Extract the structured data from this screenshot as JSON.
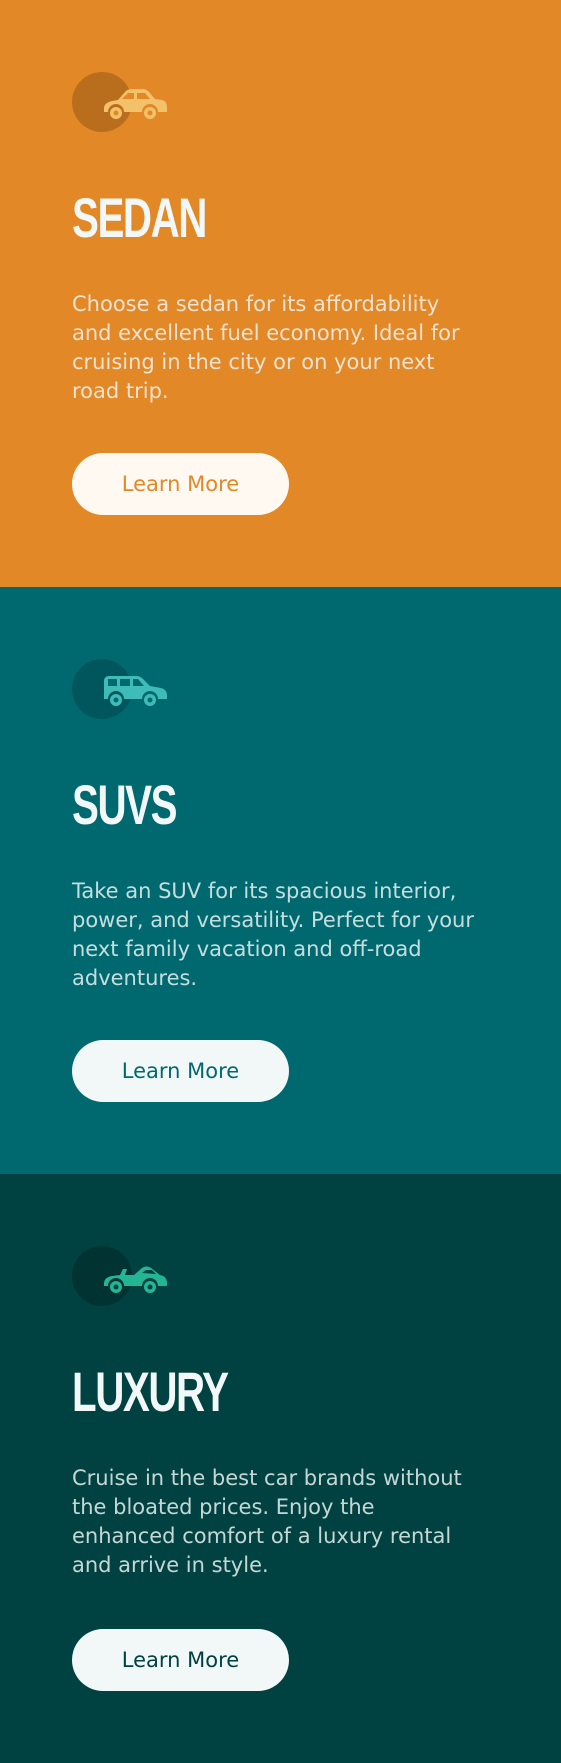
{
  "cards": [
    {
      "icon": "sedan-car-icon",
      "icon_color": "#f2c169",
      "title": "SEDAN",
      "description": "Choose a sedan for its affordability and excellent fuel economy. Ideal for cruising in the city or on your next road trip.",
      "button_label": "Learn More",
      "background": "#e38826"
    },
    {
      "icon": "suv-car-icon",
      "icon_color": "#3fbcb7",
      "title": "SUVS",
      "description": "Take an SUV for its spacious interior, power, and versatility. Perfect for your next family vacation and off-road adventures.",
      "button_label": "Learn More",
      "background": "#006970"
    },
    {
      "icon": "luxury-car-icon",
      "icon_color": "#23b594",
      "title": "LUXURY",
      "description": "Cruise in the best car brands without the bloated prices. Enjoy the enhanced comfort of a luxury rental and arrive in style.",
      "button_label": "Learn More",
      "background": "#004241"
    }
  ]
}
